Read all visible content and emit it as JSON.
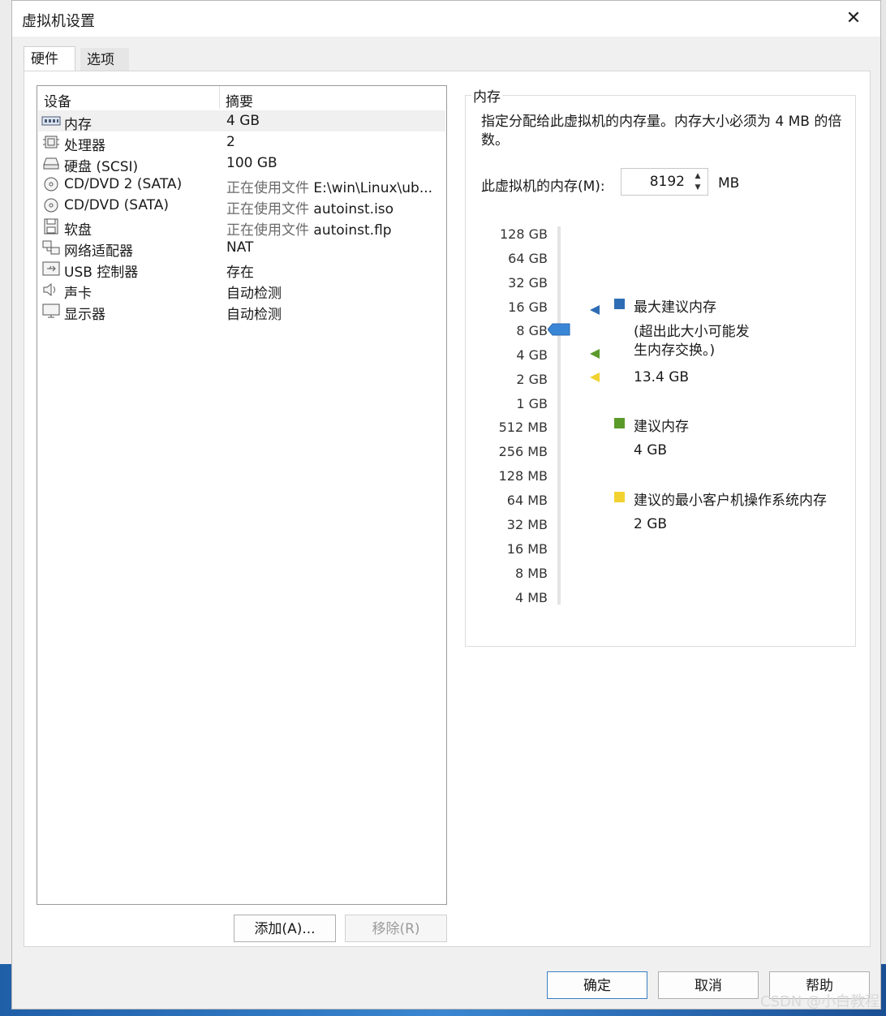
{
  "dialog": {
    "title": "虚拟机设置"
  },
  "tabs": [
    {
      "label": "硬件"
    },
    {
      "label": "选项"
    }
  ],
  "device_table": {
    "headers": {
      "device": "设备",
      "summary": "摘要"
    },
    "rows": [
      {
        "name": "内存",
        "summary": "4 GB",
        "icon": "memory-icon"
      },
      {
        "name": "处理器",
        "summary": "2",
        "icon": "cpu-icon"
      },
      {
        "name": "硬盘 (SCSI)",
        "summary": "100 GB",
        "icon": "harddisk-icon"
      },
      {
        "name": "CD/DVD 2 (SATA)",
        "summary_prefix": "正在使用文件",
        "summary": "E:\\win\\Linux\\ub...",
        "icon": "cd-icon"
      },
      {
        "name": "CD/DVD (SATA)",
        "summary_prefix": "正在使用文件",
        "summary": "autoinst.iso",
        "icon": "cd-icon"
      },
      {
        "name": "软盘",
        "summary_prefix": "正在使用文件",
        "summary": "autoinst.flp",
        "icon": "floppy-icon"
      },
      {
        "name": "网络适配器",
        "summary": "NAT",
        "icon": "network-icon"
      },
      {
        "name": "USB 控制器",
        "summary": "存在",
        "icon": "usb-icon"
      },
      {
        "name": "声卡",
        "summary": "自动检测",
        "icon": "speaker-icon"
      },
      {
        "name": "显示器",
        "summary": "自动检测",
        "icon": "monitor-icon"
      }
    ]
  },
  "device_buttons": {
    "add": "添加(A)...",
    "remove": "移除(R)"
  },
  "memory": {
    "group_title": "内存",
    "description": "指定分配给此虚拟机的内存量。内存大小必须为 4 MB 的倍数。",
    "field_label": "此虚拟机的内存(M):",
    "value": "8192",
    "unit": "MB",
    "scale": [
      "128 GB",
      "64 GB",
      "32 GB",
      "16 GB",
      "8 GB",
      "4 GB",
      "2 GB",
      "1 GB",
      "512 MB",
      "256 MB",
      "128 MB",
      "64 MB",
      "32 MB",
      "16 MB",
      "8 MB",
      "4 MB"
    ],
    "legend": {
      "max_label": "最大建议内存",
      "max_note": "(超出此大小可能发生内存交换。)",
      "max_value": "13.4 GB",
      "recommended_label": "建议内存",
      "recommended_value": "4 GB",
      "min_label": "建议的最小客户机操作系统内存",
      "min_value": "2 GB"
    },
    "colors": {
      "max": "#2e6db4",
      "recommended": "#5a9a2a",
      "min": "#f2d230",
      "thumb": "#3a86d6"
    }
  },
  "footer_buttons": {
    "ok": "确定",
    "cancel": "取消",
    "help": "帮助"
  },
  "watermark": "CSDN @小白教程"
}
